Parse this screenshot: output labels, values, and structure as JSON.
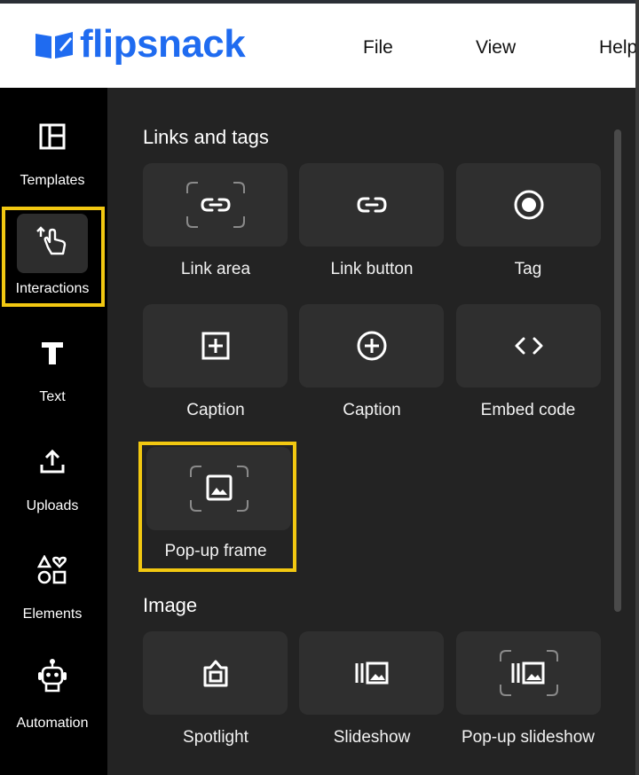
{
  "header": {
    "brand": "flipsnack",
    "menu": {
      "file": "File",
      "view": "View",
      "help": "Help"
    },
    "brand_color": "#1f6bf0"
  },
  "sidebar": {
    "items": [
      {
        "label": "Templates",
        "icon": "templates-icon"
      },
      {
        "label": "Interactions",
        "icon": "interactions-icon",
        "active": true
      },
      {
        "label": "Text",
        "icon": "text-icon"
      },
      {
        "label": "Uploads",
        "icon": "upload-icon"
      },
      {
        "label": "Elements",
        "icon": "elements-icon"
      },
      {
        "label": "Automation",
        "icon": "robot-icon"
      }
    ],
    "highlight_color": "#f2c811"
  },
  "panel": {
    "links_title": "Links and tags",
    "image_title": "Image",
    "links": [
      {
        "label": "Link area",
        "icon": "link-area-icon"
      },
      {
        "label": "Link button",
        "icon": "link-icon"
      },
      {
        "label": "Tag",
        "icon": "tag-radio-icon"
      },
      {
        "label": "Caption",
        "icon": "caption-plus-square-icon"
      },
      {
        "label": "Caption",
        "icon": "caption-plus-circle-icon"
      },
      {
        "label": "Embed code",
        "icon": "code-icon"
      },
      {
        "label": "Pop-up frame",
        "icon": "popup-frame-icon",
        "highlighted": true
      }
    ],
    "image": [
      {
        "label": "Spotlight",
        "icon": "spotlight-icon"
      },
      {
        "label": "Slideshow",
        "icon": "slideshow-icon"
      },
      {
        "label": "Pop-up slideshow",
        "icon": "popup-slideshow-icon"
      }
    ]
  }
}
